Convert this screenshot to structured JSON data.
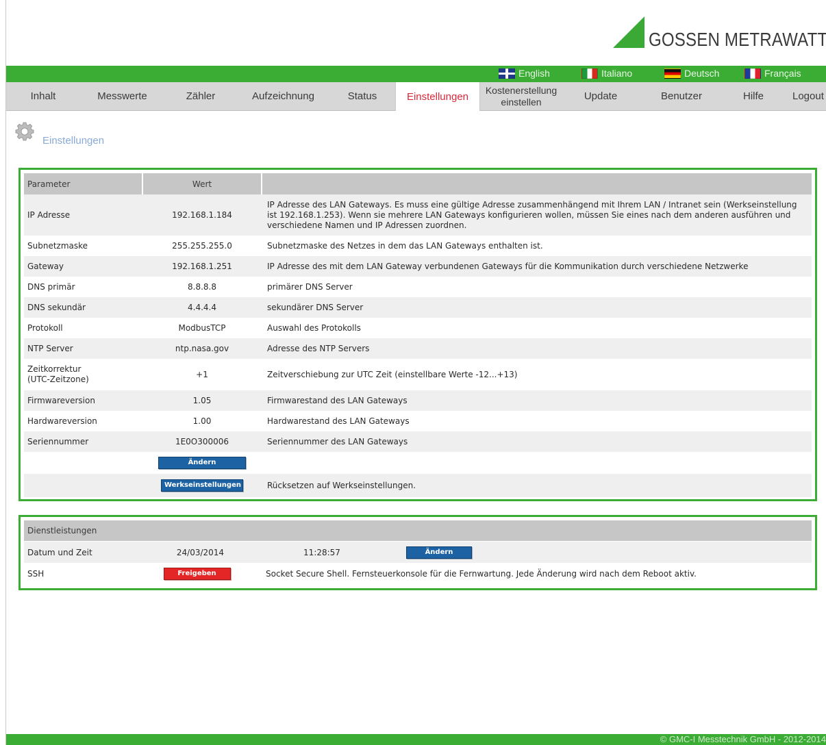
{
  "brand": {
    "name": "GOSSEN METRAWATT",
    "accent": "#3bac34"
  },
  "languages": [
    {
      "label": "English",
      "flag": "uk-flag-icon"
    },
    {
      "label": "Italiano",
      "flag": "italy-flag-icon"
    },
    {
      "label": "Deutsch",
      "flag": "germany-flag-icon"
    },
    {
      "label": "Français",
      "flag": "france-flag-icon"
    }
  ],
  "nav": [
    {
      "label": "Inhalt"
    },
    {
      "label": "Messwerte"
    },
    {
      "label": "Zähler"
    },
    {
      "label": "Aufzeichnung"
    },
    {
      "label": "Status"
    },
    {
      "label": "Einstellungen",
      "active": true
    },
    {
      "label": "Kostenerstellung einstellen"
    },
    {
      "label": "Update"
    },
    {
      "label": "Benutzer"
    },
    {
      "label": "Hilfe"
    },
    {
      "label": "Logout"
    }
  ],
  "page": {
    "title": "Einstellungen",
    "icon": "gear-icon"
  },
  "settings": {
    "headers": {
      "parameter": "Parameter",
      "value": "Wert",
      "description": ""
    },
    "rows": [
      {
        "param": "IP Adresse",
        "value": "192.168.1.184",
        "desc": "IP Adresse des LAN Gateways. Es muss eine gültige Adresse zusammenhängend mit Ihrem LAN / Intranet sein (Werkseinstellung ist 192.168.1.253). Wenn sie mehrere LAN Gateways konfigurieren wollen, müssen Sie eines nach dem anderen ausführen und verschiedene Namen und IP Adressen zuordnen."
      },
      {
        "param": "Subnetzmaske",
        "value": "255.255.255.0",
        "desc": "Subnetzmaske des Netzes in dem das LAN Gateways enthalten ist."
      },
      {
        "param": "Gateway",
        "value": "192.168.1.251",
        "desc": "IP Adresse des mit dem LAN Gateway verbundenen Gateways für die Kommunikation durch verschiedene Netzwerke"
      },
      {
        "param": "DNS primär",
        "value": "8.8.8.8",
        "desc": "primärer DNS Server"
      },
      {
        "param": "DNS sekundär",
        "value": "4.4.4.4",
        "desc": "sekundärer DNS Server"
      },
      {
        "param": "Protokoll",
        "value": "ModbusTCP",
        "desc": "Auswahl des Protokolls"
      },
      {
        "param": "NTP Server",
        "value": "ntp.nasa.gov",
        "desc": "Adresse des NTP Servers"
      },
      {
        "param": "Zeitkorrektur (UTC-Zeitzone)",
        "value": "+1",
        "desc": "Zeitverschiebung zur UTC Zeit (einstellbare Werte -12...+13)"
      },
      {
        "param": "Firmwareversion",
        "value": "1.05",
        "desc": "Firmwarestand des LAN Gateways"
      },
      {
        "param": "Hardwareversion",
        "value": "1.00",
        "desc": "Hardwarestand des LAN Gateways"
      },
      {
        "param": "Seriennummer",
        "value": "1E0O300006",
        "desc": "Seriennummer des LAN Gateways"
      }
    ],
    "change_button": "Ändern",
    "factory_button": "Werkseinstellungen",
    "factory_desc": "Rücksetzen auf Werkseinstellungen."
  },
  "services": {
    "header": "Dienstleistungen",
    "datetime": {
      "label": "Datum und Zeit",
      "date": "24/03/2014",
      "time": "11:28:57",
      "button": "Ändern"
    },
    "ssh": {
      "label": "SSH",
      "button": "Freigeben",
      "button_color": "#e42626",
      "desc": "Socket Secure Shell. Fernsteuerkonsole für die Fernwartung. Jede Änderung wird nach dem Reboot aktiv."
    }
  },
  "footer": {
    "text": "© GMC-I Messtechnik GmbH - 2012-2014"
  }
}
